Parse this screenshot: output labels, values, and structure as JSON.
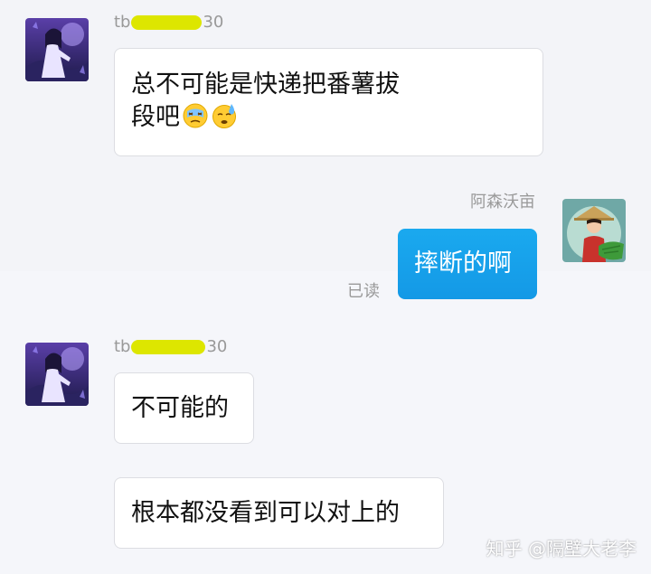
{
  "conversation": {
    "messages": [
      {
        "sender_prefix": "tb",
        "sender_suffix": "30",
        "lines": [
          "总不可能是快递把番薯拔",
          "段吧"
        ],
        "emojis": [
          "dizzy-face-emoji",
          "sweating-face-emoji"
        ]
      },
      {
        "sender_name": "阿森沃亩",
        "text": "摔断的啊",
        "status": "已读"
      },
      {
        "sender_prefix": "tb",
        "sender_suffix": "30",
        "text": "不可能的"
      },
      {
        "text": "根本都没看到可以对上的"
      }
    ]
  },
  "watermark": "知乎 @隔壁大老李",
  "colors": {
    "background": "#f3f4f8",
    "outgoing_bubble": "#1aa9ef",
    "incoming_bubble": "#ffffff",
    "redaction_highlight": "#dde600",
    "meta_text": "#999999"
  },
  "icons": {
    "incoming_avatar": "avatar-fantasy-character",
    "outgoing_avatar": "avatar-farmer-with-hat"
  }
}
